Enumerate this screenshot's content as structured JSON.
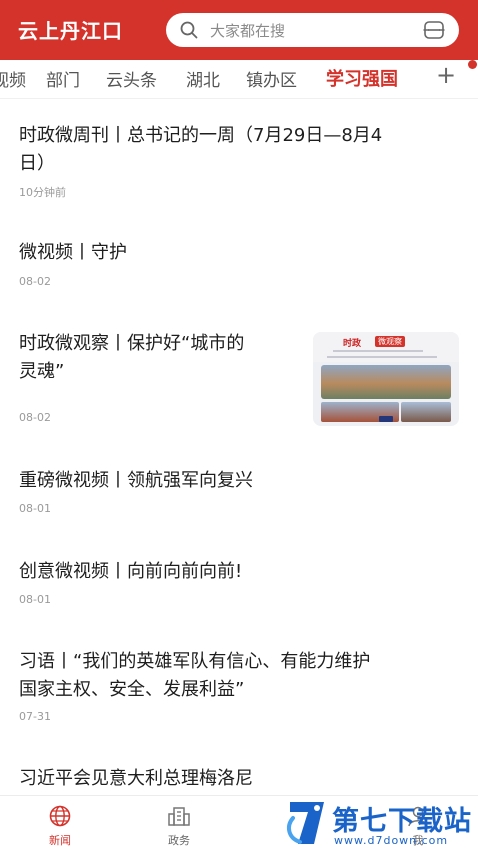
{
  "header": {
    "app_title": "云上丹江口",
    "search_placeholder": "大家都在搜"
  },
  "tabs": [
    {
      "label": "视频",
      "active": false
    },
    {
      "label": "部门",
      "active": false
    },
    {
      "label": "云头条",
      "active": false
    },
    {
      "label": "湖北",
      "active": false
    },
    {
      "label": "镇办区",
      "active": false
    },
    {
      "label": "学习强国",
      "active": true
    }
  ],
  "tab_add_label": "+",
  "news": [
    {
      "title_line1": "时政微周刊丨总书记的一周（7月29日—8月4",
      "title_line2": "日）",
      "time": "10分钟前"
    },
    {
      "title_line1": "微视频丨守护",
      "time": "08-02"
    },
    {
      "title_line1": "时政微观察丨保护好“城市的",
      "title_line2": "灵魂”",
      "time": "08-02",
      "thumb_label": "时政",
      "thumb_badge": "微观察"
    },
    {
      "title_line1": "重磅微视频丨领航强军向复兴",
      "time": "08-01"
    },
    {
      "title_line1": "创意微视频丨向前向前向前!",
      "time": "08-01"
    },
    {
      "title_line1": "习语丨“我们的英雄军队有信心、有能力维护",
      "title_line2": "国家主权、安全、发展利益”",
      "time": "07-31"
    },
    {
      "title_line1": "习近平会见意大利总理梅洛尼"
    }
  ],
  "bottom_nav": [
    {
      "label": "新闻",
      "icon": "globe-icon",
      "active": true
    },
    {
      "label": "政务",
      "icon": "building-icon",
      "active": false
    },
    {
      "label": "我",
      "icon": "person-icon",
      "active": false
    }
  ],
  "watermark": {
    "title": "第七下载站",
    "url": "www.d7down.com"
  },
  "colors": {
    "brand_red": "#d4332b",
    "watermark_blue": "#1a63c9"
  }
}
